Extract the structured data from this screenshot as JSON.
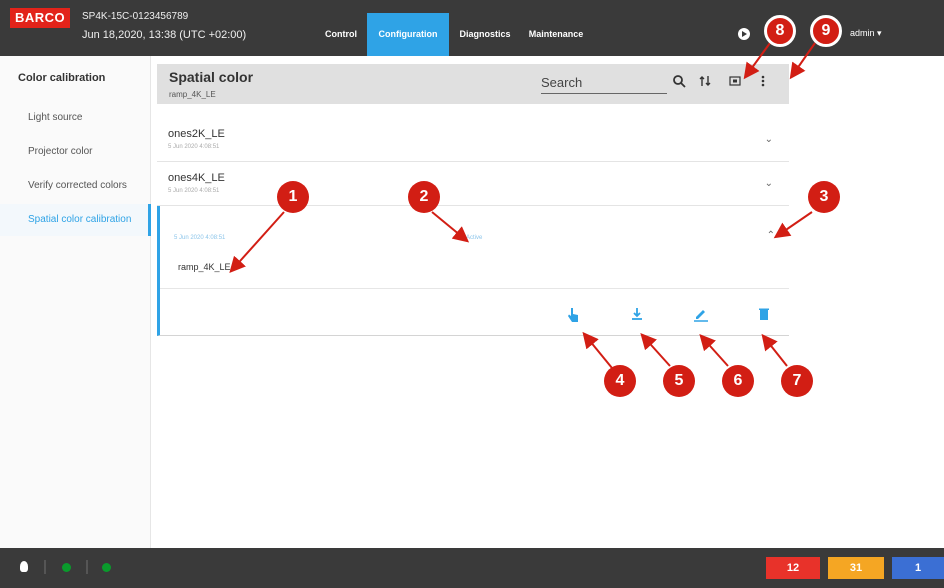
{
  "header": {
    "logo_text": "BARCO",
    "device_name": "SP4K-15C-0123456789",
    "datetime": "Jun 18,2020, 13:38 (UTC +02:00)",
    "tabs": [
      {
        "label": "Control",
        "active": false
      },
      {
        "label": "Configuration",
        "active": true
      },
      {
        "label": "Diagnostics",
        "active": false
      },
      {
        "label": "Maintenance",
        "active": false
      }
    ],
    "user": "admin ▾"
  },
  "sidebar": {
    "title": "Color calibration",
    "items": [
      {
        "label": "Light source",
        "active": false
      },
      {
        "label": "Projector color",
        "active": false
      },
      {
        "label": "Verify corrected colors",
        "active": false
      },
      {
        "label": "Spatial color calibration",
        "active": true
      }
    ]
  },
  "panel": {
    "title": "Spatial color",
    "subtitle": "ramp_4K_LE",
    "search_placeholder": "Search"
  },
  "rows": [
    {
      "name": "ones2K_LE",
      "date": "5 Jun 2020 4:08:51"
    },
    {
      "name": "ones4K_LE",
      "date": "5 Jun 2020 4:08:51"
    }
  ],
  "expanded": {
    "date": "5 Jun 2020 4:08:51",
    "status": "Active",
    "name": "ramp_4K_LE"
  },
  "callouts": [
    "1",
    "2",
    "3",
    "4",
    "5",
    "6",
    "7",
    "8",
    "9"
  ],
  "status_counts": [
    {
      "value": "12",
      "color": "#e8322a"
    },
    {
      "value": "31",
      "color": "#f5a623"
    },
    {
      "value": "1",
      "color": "#3b6fd4"
    }
  ],
  "colors": {
    "accent": "#2fa3e6",
    "brand": "#e2231a",
    "bar": "#3a3a3a",
    "callout": "#d21e14"
  },
  "icons": [
    "search-icon",
    "sort-icon",
    "fullscreen-icon",
    "more-vert-icon",
    "activate-icon",
    "download-icon",
    "edit-icon",
    "delete-icon",
    "chevron-down-icon",
    "chevron-up-icon",
    "play-icon",
    "lightbulb-icon"
  ]
}
